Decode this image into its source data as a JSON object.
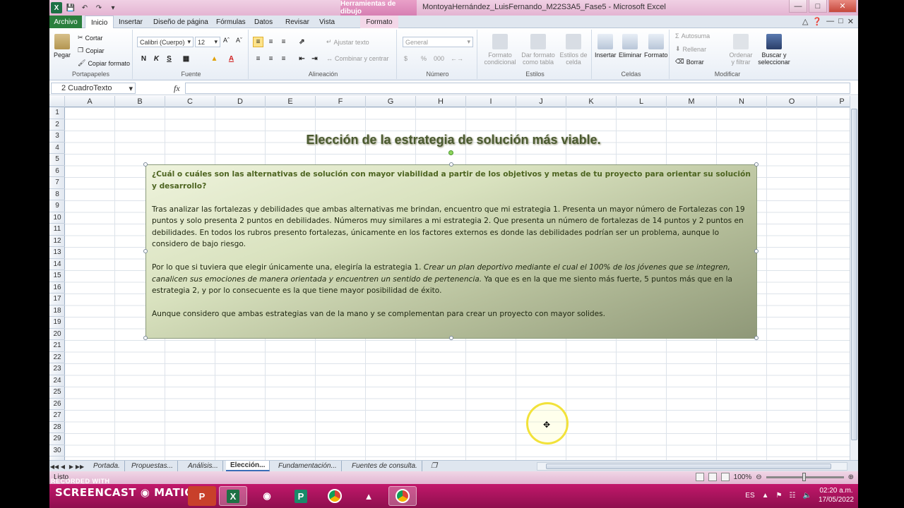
{
  "window": {
    "doc_title": "MontoyaHernández_LuisFernando_M22S3A5_Fase5 - Microsoft Excel",
    "context_tab_title": "Herramientas de dibujo",
    "controls": {
      "minimize": "—",
      "maximize": "□",
      "close": "✕"
    }
  },
  "tabs": {
    "file": "Archivo",
    "items": [
      "Inicio",
      "Insertar",
      "Diseño de página",
      "Fórmulas",
      "Datos",
      "Revisar",
      "Vista",
      "Formato"
    ]
  },
  "ribbon": {
    "portapapeles": {
      "label": "Portapapeles",
      "paste": "Pegar",
      "cut": "Cortar",
      "copy": "Copiar",
      "format_painter": "Copiar formato"
    },
    "fuente": {
      "label": "Fuente",
      "font": "Calibri (Cuerpo)",
      "size": "12",
      "bold": "N",
      "italic": "K",
      "underline": "S"
    },
    "alineacion": {
      "label": "Alineación",
      "wrap": "Ajustar texto",
      "merge": "Combinar y centrar"
    },
    "numero": {
      "label": "Número",
      "format": "General",
      "percent": "%",
      "thousands": "000",
      "currency": "$"
    },
    "estilos": {
      "label": "Estilos",
      "cond": "Formato condicional",
      "table": "Dar formato como tabla",
      "cell": "Estilos de celda"
    },
    "celdas": {
      "label": "Celdas",
      "insert": "Insertar",
      "delete": "Eliminar",
      "format": "Formato"
    },
    "modificar": {
      "label": "Modificar",
      "autosum": "Autosuma",
      "fill": "Rellenar",
      "clear": "Borrar",
      "sort": "Ordenar y filtrar",
      "find": "Buscar y seleccionar"
    }
  },
  "formula_bar": {
    "name_box": "2 CuadroTexto",
    "fx": "fx",
    "value": ""
  },
  "columns": [
    "A",
    "B",
    "C",
    "D",
    "E",
    "F",
    "G",
    "H",
    "I",
    "J",
    "K",
    "L",
    "M",
    "N",
    "O",
    "P"
  ],
  "rows": [
    "1",
    "2",
    "3",
    "4",
    "5",
    "6",
    "7",
    "8",
    "9",
    "10",
    "11",
    "12",
    "13",
    "14",
    "15",
    "16",
    "17",
    "18",
    "19",
    "20",
    "21",
    "22",
    "23",
    "24",
    "25",
    "26",
    "27",
    "28",
    "29",
    "30"
  ],
  "sheet": {
    "title": "Elección de la estrategia de solución más viable.",
    "textbox": {
      "question": "¿Cuál o cuáles son las alternativas de solución con mayor viabilidad a partir de los objetivos y metas de tu proyecto para orientar su solución y desarrollo?",
      "p1": "Tras analizar las fortalezas y debilidades que ambas alternativas me brindan, encuentro que mi estrategia 1. Presenta un mayor número de Fortalezas con 19 puntos y solo presenta 2 puntos en  debilidades. Números muy similares a mi estrategia 2.  Que presenta un número de fortalezas de 14 puntos y 2 puntos en debilidades. En todos los rubros presento fortalezas, únicamente en los factores externos es donde las debilidades podrían ser un problema, aunque lo considero de bajo riesgo.",
      "p2_start": "Por lo que si tuviera que elegir únicamente una, elegiría la estrategia 1. ",
      "p2_italic": "Crear un plan deportivo  mediante  el cual el 100% de los jóvenes que se integren, canalicen sus emociones de manera orientada y encuentren un sentido de pertenencia.",
      "p2_end": "   Ya que es en la que me siento más fuerte, 5 puntos más que en la estrategia 2,  y por lo consecuente es la que tiene mayor posibilidad de éxito.",
      "p3": "Aunque considero que ambas estrategias van de la mano y se complementan para crear un proyecto con mayor solides."
    }
  },
  "sheet_tabs": [
    "Portada.",
    "Propuestas...",
    "Análisis...",
    "Elección...",
    "Fundamentación...",
    "Fuentes de consulta."
  ],
  "active_sheet_tab": "Elección...",
  "status": {
    "left": "Listo",
    "zoom": "100%"
  },
  "taskbar": {
    "recorded": "RECORDED WITH",
    "brand": "SCREENCAST",
    "brand2": "MATIC",
    "lang": "ES",
    "time": "02:20 a.m.",
    "date": "17/05/2022"
  }
}
